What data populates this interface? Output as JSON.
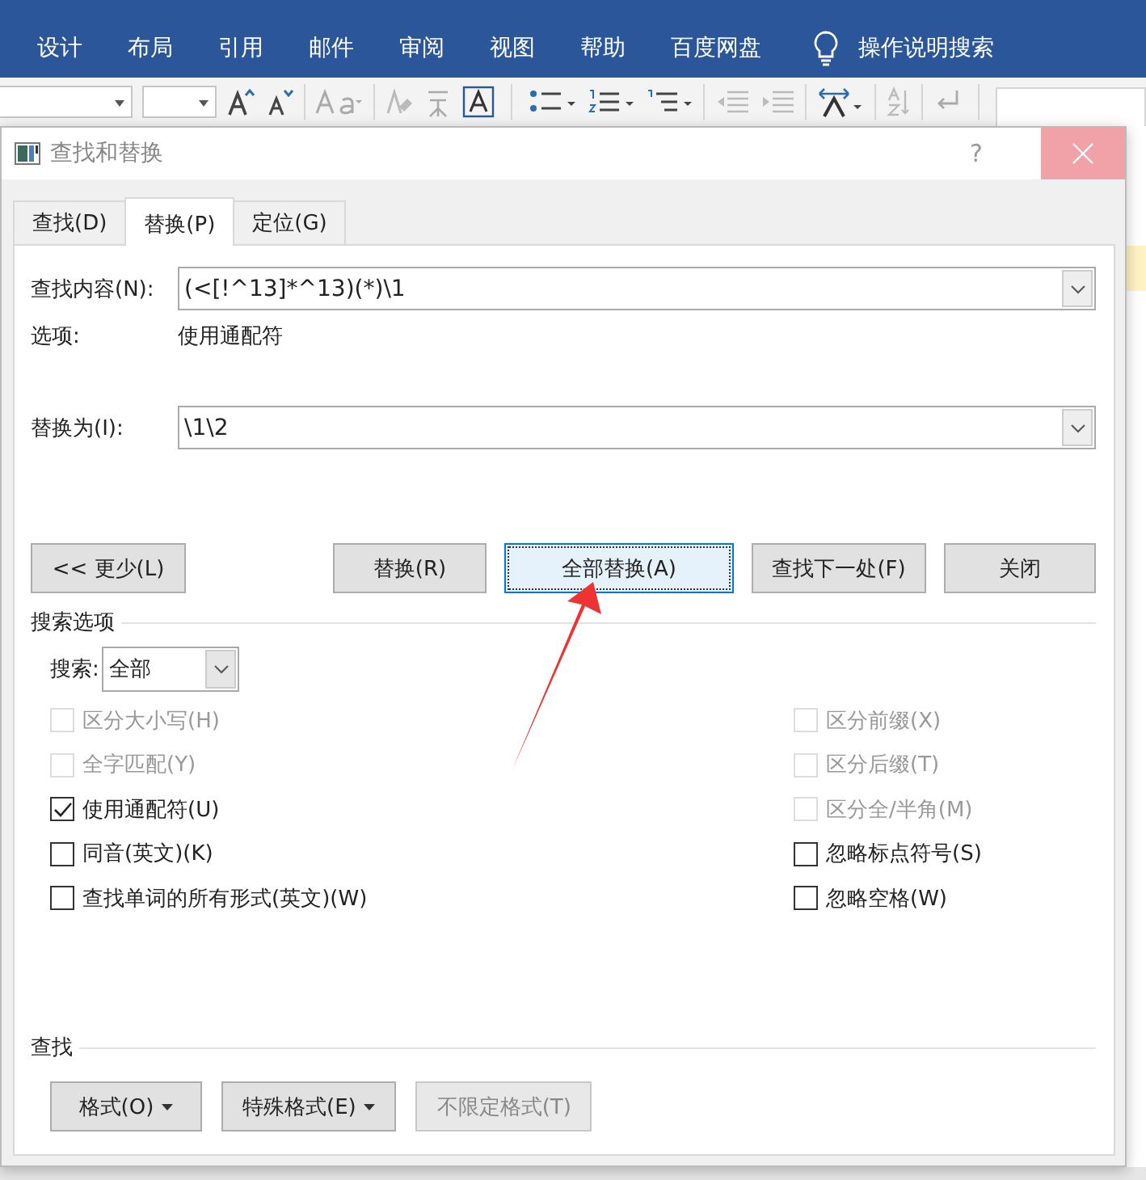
{
  "ribbon_tabs": [
    "设计",
    "布局",
    "引用",
    "邮件",
    "审阅",
    "视图",
    "帮助",
    "百度网盘"
  ],
  "tell_me": "操作说明搜索",
  "dialog": {
    "title": "查找和替换",
    "help": "?",
    "tabs": [
      {
        "label": "查找(D)",
        "selected": false
      },
      {
        "label": "替换(P)",
        "selected": true
      },
      {
        "label": "定位(G)",
        "selected": false
      }
    ],
    "find": {
      "label": "查找内容(N):",
      "value": "(<[!^13]*^13)(*)\\1"
    },
    "options": {
      "label": "选项:",
      "value": "使用通配符"
    },
    "replace": {
      "label": "替换为(I):",
      "value": "\\1\\2"
    },
    "less_button": "<< 更少(L)",
    "buttons": [
      {
        "label": "替换(R)",
        "focused": false
      },
      {
        "label": "全部替换(A)",
        "focused": true
      },
      {
        "label": "查找下一处(F)",
        "focused": false
      },
      {
        "label": "关闭",
        "focused": false
      }
    ],
    "search_options": {
      "heading": "搜索选项",
      "search_label": "搜索:",
      "search_value": "全部",
      "left": [
        {
          "label": "区分大小写(H)",
          "checked": false,
          "disabled": true
        },
        {
          "label": "全字匹配(Y)",
          "checked": false,
          "disabled": true
        },
        {
          "label": "使用通配符(U)",
          "checked": true,
          "disabled": false
        },
        {
          "label": "同音(英文)(K)",
          "checked": false,
          "disabled": false
        },
        {
          "label": "查找单词的所有形式(英文)(W)",
          "checked": false,
          "disabled": false
        }
      ],
      "right": [
        {
          "label": "区分前缀(X)",
          "checked": false,
          "disabled": true
        },
        {
          "label": "区分后缀(T)",
          "checked": false,
          "disabled": true
        },
        {
          "label": "区分全/半角(M)",
          "checked": false,
          "disabled": true
        },
        {
          "label": "忽略标点符号(S)",
          "checked": false,
          "disabled": false
        },
        {
          "label": "忽略空格(W)",
          "checked": false,
          "disabled": false
        }
      ]
    },
    "find_section": {
      "heading": "查找",
      "buttons": [
        {
          "label": "格式(O)",
          "menu": true,
          "disabled": false
        },
        {
          "label": "特殊格式(E)",
          "menu": true,
          "disabled": false
        },
        {
          "label": "不限定格式(T)",
          "menu": false,
          "disabled": true
        }
      ]
    }
  }
}
